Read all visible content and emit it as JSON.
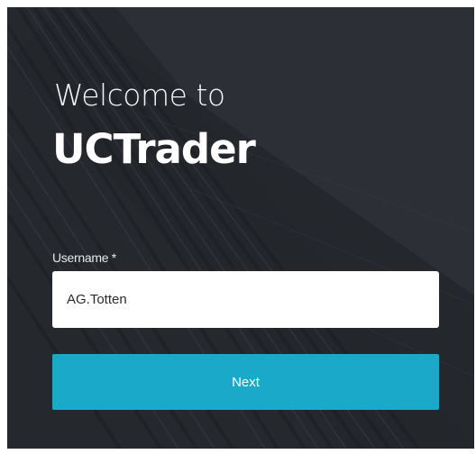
{
  "login": {
    "welcome_text": "Welcome to",
    "brand_name": "UCTrader",
    "username_label": "Username *",
    "username_value": "AG.Totten",
    "next_label": "Next"
  },
  "colors": {
    "panel_background": "#2f3238",
    "accent_button": "#1aa9c9",
    "input_background": "#ffffff",
    "text_light": "#ffffff"
  }
}
